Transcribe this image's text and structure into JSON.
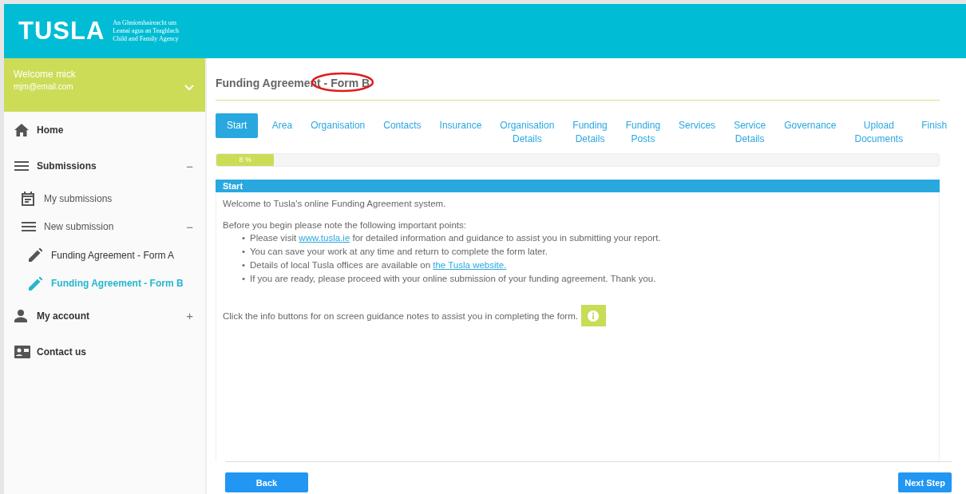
{
  "header": {
    "logo": "TUSLA",
    "tagline": [
      "An Ghníomhaireacht um",
      "Leanaí agus an Teaghlach",
      "Child and Family Agency"
    ]
  },
  "user": {
    "greeting": "Welcome mick",
    "email": "mjm@email.com"
  },
  "sidebar": {
    "items": [
      {
        "label": "Home",
        "selected": false
      },
      {
        "label": "Submissions",
        "toggle": "−",
        "selected": false,
        "children": [
          {
            "label": "My submissions",
            "selected": false
          },
          {
            "label": "New submission",
            "toggle": "−",
            "selected": false,
            "children": [
              {
                "label": "Funding Agreement - Form A",
                "selected": false
              },
              {
                "label": "Funding Agreement - Form B",
                "selected": true
              }
            ]
          }
        ]
      },
      {
        "label": "My account",
        "toggle": "+",
        "selected": false
      },
      {
        "label": "Contact us",
        "selected": false
      }
    ]
  },
  "page": {
    "title": "Funding Agreement",
    "title_suffix": " - Form B",
    "annotation_circled": true
  },
  "steps": [
    {
      "lines": [
        "Start"
      ],
      "selected": true
    },
    {
      "lines": [
        "Area"
      ],
      "selected": false
    },
    {
      "lines": [
        "Organisation"
      ],
      "selected": false
    },
    {
      "lines": [
        "Contacts"
      ],
      "selected": false
    },
    {
      "lines": [
        "Insurance"
      ],
      "selected": false
    },
    {
      "lines": [
        "Organisation",
        "Details"
      ],
      "selected": false
    },
    {
      "lines": [
        "Funding",
        "Details"
      ],
      "selected": false
    },
    {
      "lines": [
        "Funding",
        "Posts"
      ],
      "selected": false
    },
    {
      "lines": [
        "Services"
      ],
      "selected": false
    },
    {
      "lines": [
        "Service",
        "Details"
      ],
      "selected": false
    },
    {
      "lines": [
        "Governance"
      ],
      "selected": false
    },
    {
      "lines": [
        "Upload",
        "Documents"
      ],
      "selected": false
    },
    {
      "lines": [
        "Finish"
      ],
      "selected": false
    }
  ],
  "progress": {
    "level": 0.08,
    "label": "8 %"
  },
  "section": {
    "title": "Start",
    "intro": "Welcome to Tusla's online Funding Agreement system.",
    "lead": "Before you begin please note the following important points:",
    "points": [
      {
        "marker": "•",
        "before": "Please visit ",
        "link": "www.tusla.ie",
        "after": " for detailed information and guidance to assist you in submitting your report."
      },
      {
        "marker": "•",
        "before": "You can save your work at any time and return to complete the form later."
      },
      {
        "marker": "•",
        "before": "Details of local Tusla offices are available on ",
        "link": "the Tusla website."
      },
      {
        "marker": "•",
        "before": "If you are ready, please proceed with your online submission of your funding agreement. Thank you."
      }
    ],
    "info_note": "Click the info buttons for on screen guidance notes to assist you in completing the form."
  },
  "buttons": {
    "back": "Back",
    "next": "Next Step"
  }
}
